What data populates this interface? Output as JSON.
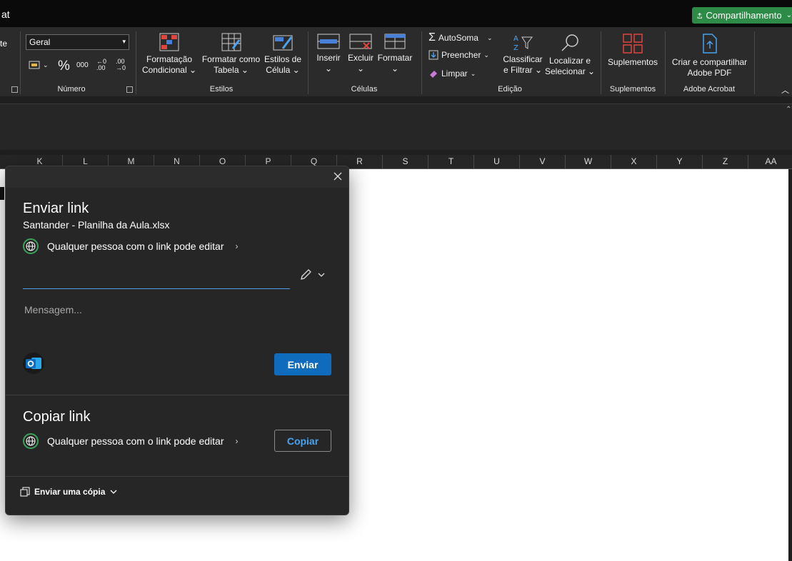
{
  "titlebar": {
    "title_fragment": "at",
    "share_button": "Compartilhamento"
  },
  "ribbon": {
    "left_fragment": "te",
    "number_format": "Geral",
    "percent_symbol": "%",
    "thousands_symbol": "000",
    "dec_increase": "←0\n.00",
    "dec_decrease": ".00\n→0",
    "groups": {
      "numero": "Número",
      "estilos": "Estilos",
      "celulas": "Células",
      "edicao": "Edição",
      "suplementos": "Suplementos",
      "adobe": "Adobe Acrobat"
    },
    "buttons": {
      "formatacao_condicional": "Formatação\nCondicional ⌄",
      "formatar_como_tabela": "Formatar como\nTabela ⌄",
      "estilos_de_celula": "Estilos de\nCélula ⌄",
      "inserir": "Inserir\n⌄",
      "excluir": "Excluir\n⌄",
      "formatar": "Formatar\n⌄",
      "autosoma": "AutoSoma",
      "preencher": "Preencher",
      "limpar": "Limpar",
      "classificar": "Classificar\ne Filtrar ⌄",
      "localizar": "Localizar e\nSelecionar ⌄",
      "suplementos": "Suplementos",
      "criar_pdf": "Criar e compartilhar\nAdobe PDF"
    }
  },
  "columns": [
    "K",
    "L",
    "M",
    "N",
    "O",
    "P",
    "Q",
    "R",
    "S",
    "T",
    "U",
    "V",
    "W",
    "X",
    "Y",
    "Z",
    "AA"
  ],
  "dialog": {
    "send_title": "Enviar link",
    "filename": "Santander - Planilha da Aula.xlsx",
    "permission": "Qualquer pessoa com o link pode editar",
    "to_placeholder": "",
    "message_placeholder": "Mensagem...",
    "send_button": "Enviar",
    "copy_title": "Copiar link",
    "copy_permission": "Qualquer pessoa com o link pode editar",
    "copy_button": "Copiar",
    "send_copy": "Enviar uma cópia"
  },
  "colors": {
    "accent": "#0f6cbd",
    "share_green": "#2e8a47",
    "globe_green": "#3aa35a"
  }
}
